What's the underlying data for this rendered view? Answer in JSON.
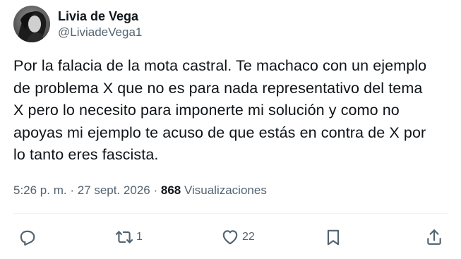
{
  "author": {
    "display_name": "Livia de Vega",
    "handle": "@LiviadeVega1"
  },
  "tweet": {
    "text": "Por la falacia de la mota castral. Te machaco con un ejemplo\nde problema X que no es para nada representativo del tema\nX pero lo necesito para imponerte mi solución y como no\napoyas mi ejemplo te acuso de que estás en contra de X por\nlo tanto eres fascista."
  },
  "meta": {
    "time": "5:26 p. m.",
    "separator": " · ",
    "date": "27 sept. 2026",
    "separator2": " · ",
    "views_count": "868",
    "views_label": " Visualizaciones"
  },
  "actions": {
    "reply": {
      "icon": "reply-icon",
      "count": ""
    },
    "retweet": {
      "icon": "retweet-icon",
      "count": "1"
    },
    "like": {
      "icon": "heart-icon",
      "count": "22"
    },
    "bookmark": {
      "icon": "bookmark-icon",
      "count": ""
    },
    "share": {
      "icon": "share-icon",
      "count": ""
    }
  },
  "colors": {
    "text_primary": "#0f1419",
    "text_secondary": "#536471",
    "divider": "#eff3f4"
  }
}
